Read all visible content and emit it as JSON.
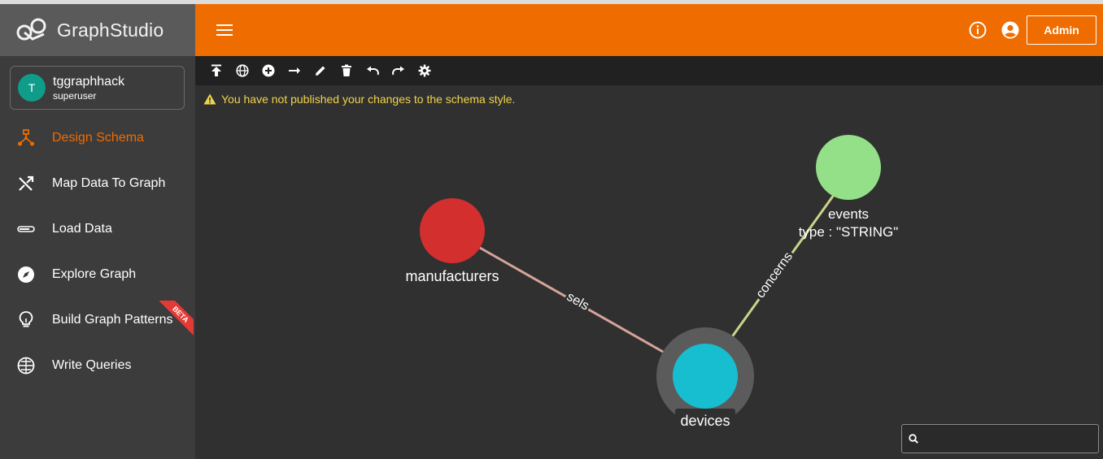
{
  "app": {
    "logo_word1": "Graph",
    "logo_word2": "Studio"
  },
  "user": {
    "initial": "T",
    "name": "tggraphhack",
    "role": "superuser"
  },
  "nav": {
    "items": [
      {
        "label": "Design Schema",
        "icon": "schema-icon",
        "active": true
      },
      {
        "label": "Map Data To Graph",
        "icon": "shuffle-icon"
      },
      {
        "label": "Load Data",
        "icon": "progress-icon"
      },
      {
        "label": "Explore Graph",
        "icon": "compass-icon"
      },
      {
        "label": "Build Graph Patterns",
        "icon": "lightbulb-icon",
        "badge": "BETA"
      },
      {
        "label": "Write Queries",
        "icon": "globe-code-icon"
      }
    ]
  },
  "header": {
    "admin_label": "Admin",
    "accent": "#ef6c00"
  },
  "toolbar": {
    "tools": [
      "publish-icon",
      "globe-icon",
      "add-vertex-icon",
      "add-edge-icon",
      "edit-icon",
      "delete-icon",
      "undo-icon",
      "redo-icon",
      "settings-icon"
    ]
  },
  "warning": {
    "text": "You have not published your changes to the schema style."
  },
  "graph": {
    "vertices": [
      {
        "name": "manufacturers",
        "color": "#d32f2f"
      },
      {
        "name": "events",
        "attr": "type : \"STRING\"",
        "color": "#94e089"
      },
      {
        "name": "devices",
        "color": "#17becf"
      }
    ],
    "edges": [
      {
        "label": "sels",
        "from": "manufacturers",
        "to": "devices"
      },
      {
        "label": "concerns",
        "from": "devices",
        "to": "events"
      }
    ]
  },
  "search": {
    "placeholder": ""
  }
}
